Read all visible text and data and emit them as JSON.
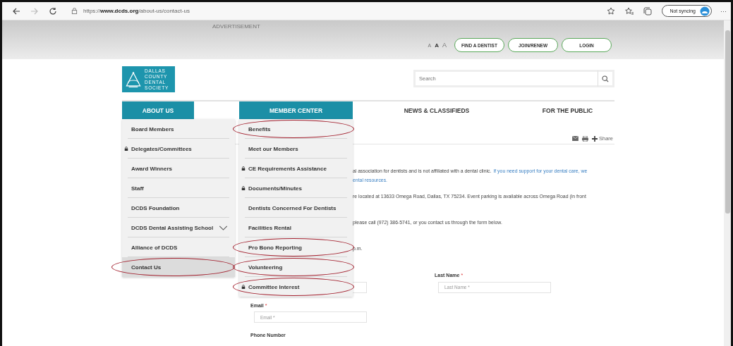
{
  "browser": {
    "url": "https://**www.dcds.org**/about-us/contact-us",
    "sync_button": "Not syncing",
    "more": "···"
  },
  "header": {
    "advertisement": "ADVERTISEMENT",
    "font_sizes": [
      "A",
      "A",
      "A"
    ],
    "buttons": [
      "FIND A DENTIST",
      "JOIN/RENEW",
      "LOGIN"
    ]
  },
  "logo": {
    "lines": [
      "DALLAS",
      "COUNTY",
      "DENTAL",
      "SOCIETY"
    ]
  },
  "search": {
    "placeholder": "Search"
  },
  "nav": [
    {
      "label": "ABOUT US",
      "expanded": true,
      "menu": [
        {
          "label": "Board Members",
          "locked": false,
          "has_submenu": false,
          "selected": false,
          "circled": false
        },
        {
          "label": "Delegates/Committees",
          "locked": true,
          "has_submenu": false,
          "selected": false,
          "circled": false
        },
        {
          "label": "Award Winners",
          "locked": false,
          "has_submenu": false,
          "selected": false,
          "circled": false
        },
        {
          "label": "Staff",
          "locked": false,
          "has_submenu": false,
          "selected": false,
          "circled": false
        },
        {
          "label": "DCDS Foundation",
          "locked": false,
          "has_submenu": false,
          "selected": false,
          "circled": false
        },
        {
          "label": "DCDS Dental Assisting School",
          "locked": false,
          "has_submenu": true,
          "selected": false,
          "circled": false
        },
        {
          "label": "Alliance of DCDS",
          "locked": false,
          "has_submenu": false,
          "selected": false,
          "circled": false
        },
        {
          "label": "Contact Us",
          "locked": false,
          "has_submenu": false,
          "selected": true,
          "circled": true
        }
      ]
    },
    {
      "label": "MEMBER CENTER",
      "expanded": true,
      "menu": [
        {
          "label": "Benefits",
          "locked": false,
          "has_submenu": false,
          "selected": false,
          "circled": true
        },
        {
          "label": "Meet our Members",
          "locked": false,
          "has_submenu": false,
          "selected": false,
          "circled": false
        },
        {
          "label": "CE Requirements Assistance",
          "locked": true,
          "has_submenu": false,
          "selected": false,
          "circled": false
        },
        {
          "label": "Documents/Minutes",
          "locked": true,
          "has_submenu": false,
          "selected": false,
          "circled": false
        },
        {
          "label": "Dentists Concerned For Dentists",
          "locked": false,
          "has_submenu": false,
          "selected": false,
          "circled": false
        },
        {
          "label": "Facilities Rental",
          "locked": false,
          "has_submenu": false,
          "selected": false,
          "circled": false
        },
        {
          "label": "Pro Bono Reporting",
          "locked": false,
          "has_submenu": false,
          "selected": false,
          "circled": true
        },
        {
          "label": "Volunteering",
          "locked": false,
          "has_submenu": false,
          "selected": false,
          "circled": true
        },
        {
          "label": "Committee Interest",
          "locked": true,
          "has_submenu": false,
          "selected": false,
          "circled": true
        }
      ]
    },
    {
      "label": "NEWS & CLASSIFIEDS",
      "expanded": false
    },
    {
      "label": "FOR THE PUBLIC",
      "expanded": false
    }
  ],
  "share": {
    "label": "Share"
  },
  "paragraphs": [
    [
      [
        {
          "text": "al association for dentists and is not affiliated with a dental clinic.",
          "kind": "text"
        },
        {
          "text": "If you need support for your dental care, we",
          "kind": "link"
        }
      ],
      [
        {
          "text": "ental resources.",
          "kind": "link"
        }
      ]
    ],
    [
      [
        {
          "text": "re located at 13633 Omega Road, Dallas, TX 75234. Event parking is available across Omega Road (in front",
          "kind": "text"
        }
      ]
    ],
    [
      [
        {
          "text": "please call (972) 386-5741, or you contact us through the form below.",
          "kind": "text"
        }
      ]
    ],
    [
      [
        {
          "text": "p.m.",
          "kind": "text"
        }
      ]
    ]
  ],
  "form": [
    {
      "kind": "field"
    },
    {
      "kind": "field",
      "label": "Last Name",
      "required_mark": "*",
      "placeholder": "Last Name *"
    },
    {
      "kind": "field",
      "label": "Email",
      "required_mark": "*",
      "placeholder": "Email *"
    },
    {
      "kind": "label",
      "label": "Phone Number"
    }
  ]
}
